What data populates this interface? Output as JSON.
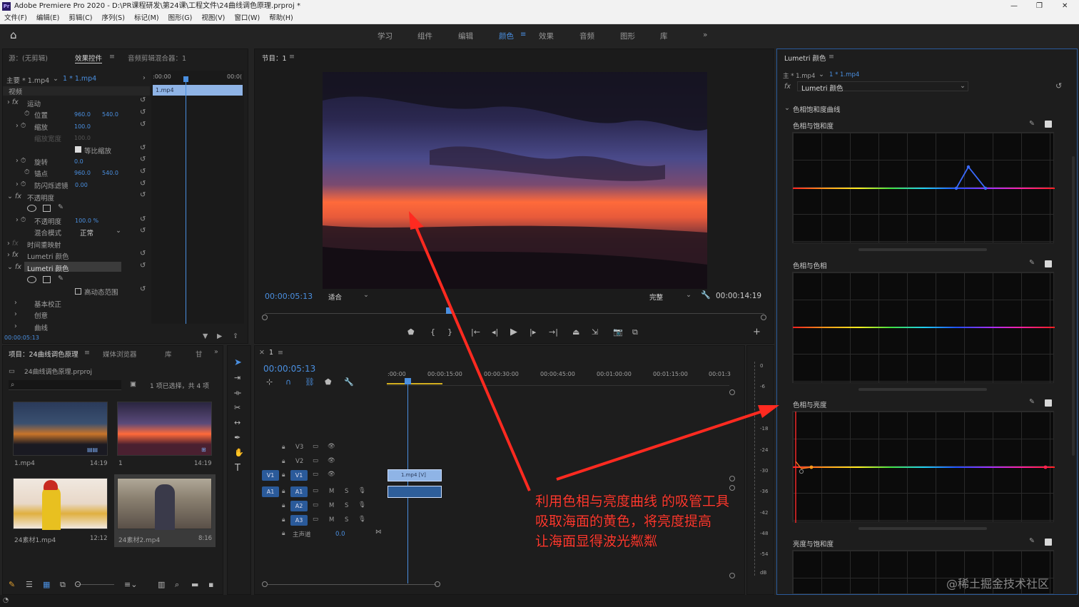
{
  "app": {
    "title": "Adobe Premiere Pro 2020 - D:\\PR课程研发\\第24课\\工程文件\\24曲线调色原理.prproj *"
  },
  "menu": [
    "文件(F)",
    "编辑(E)",
    "剪辑(C)",
    "序列(S)",
    "标记(M)",
    "图形(G)",
    "视图(V)",
    "窗口(W)",
    "帮助(H)"
  ],
  "workspaces": [
    "学习",
    "组件",
    "编辑",
    "颜色",
    "效果",
    "音频",
    "图形",
    "库"
  ],
  "active_workspace": "颜色",
  "effect_controls": {
    "tabs": [
      "源：(无剪辑)",
      "效果控件",
      "音频剪辑混合器：1"
    ],
    "header_master": "主要 * 1.mp4",
    "header_clip": "1 * 1.mp4",
    "ruler_start": ":00:00",
    "ruler_end": "00:0(",
    "clip_label": "1.mp4",
    "section_video": "视频",
    "motion": "运动",
    "position": "位置",
    "position_x": "960.0",
    "position_y": "540.0",
    "scale": "缩放",
    "scale_val": "100.0",
    "scale_width": "缩放宽度",
    "scale_width_val": "100.0",
    "uniform_scale": "等比缩放",
    "rotation": "旋转",
    "rotation_val": "0.0",
    "anchor": "锚点",
    "anchor_x": "960.0",
    "anchor_y": "540.0",
    "antiflicker": "防闪烁滤镜",
    "antiflicker_val": "0.00",
    "opacity_group": "不透明度",
    "opacity": "不透明度",
    "opacity_val": "100.0 %",
    "blend_mode": "混合模式",
    "blend_val": "正常",
    "time_remap": "时间重映射",
    "lumetri1": "Lumetri 颜色",
    "lumetri2": "Lumetri 颜色",
    "hdr": "高动态范围",
    "basic": "基本校正",
    "creative": "创意",
    "curves": "曲线",
    "timecode": "00:00:05:13"
  },
  "program": {
    "title": "节目：1",
    "timecode": "00:00:05:13",
    "fit": "适合",
    "quality": "完整",
    "duration": "00:00:14:19"
  },
  "project": {
    "tabs": [
      "项目：24曲线调色原理",
      "媒体浏览器",
      "库",
      "甘"
    ],
    "file": "24曲线调色原理.prproj",
    "selection": "1 项已选择，共 4 项",
    "items": [
      {
        "name": "1.mp4",
        "dur": "14:19"
      },
      {
        "name": "1",
        "dur": "14:19"
      },
      {
        "name": "24素材1.mp4",
        "dur": "12:12"
      },
      {
        "name": "24素材2.mp4",
        "dur": "8:16"
      }
    ]
  },
  "timeline": {
    "tab": "1",
    "timecode": "00:00:05:13",
    "ruler": [
      ":00:00",
      "00:00:15:00",
      "00:00:30:00",
      "00:00:45:00",
      "00:01:00:00",
      "00:01:15:00",
      "00:01:3"
    ],
    "tracks_v": [
      "V3",
      "V2",
      "V1"
    ],
    "tracks_a": [
      "A1",
      "A2",
      "A3"
    ],
    "source_v": "V1",
    "source_a": "A1",
    "master": "主声道",
    "master_val": "0.0",
    "clip_v": "1.mp4 [V]",
    "meter_ticks": [
      "0",
      "-6",
      "-12",
      "-18",
      "-24",
      "-30",
      "-36",
      "-42",
      "-48",
      "-54",
      "dB"
    ]
  },
  "lumetri": {
    "title": "Lumetri 颜色",
    "master": "主 * 1.mp4",
    "clip": "1 * 1.mp4",
    "effect": "Lumetri 颜色",
    "section": "色相饱和度曲线",
    "graphs": [
      "色相与饱和度",
      "色相与色相",
      "色相与亮度",
      "亮度与饱和度"
    ]
  },
  "annotation": {
    "lines": [
      "利用色相与亮度曲线 的吸管工具",
      "吸取海面的黄色，将亮度提高",
      "让海面显得波光粼粼"
    ],
    "color": "#ff3b30"
  },
  "watermark": "@稀土掘金技术社区"
}
